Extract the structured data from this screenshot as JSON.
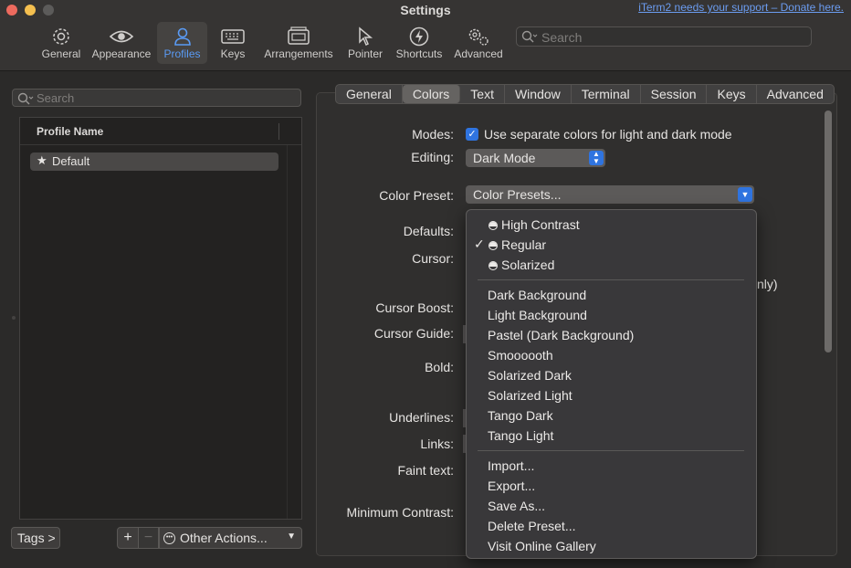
{
  "window": {
    "title": "Settings",
    "donate_link": "iTerm2 needs your support – Donate here."
  },
  "toolbar": {
    "items": [
      {
        "label": "General",
        "icon": "gear-icon"
      },
      {
        "label": "Appearance",
        "icon": "eye-icon"
      },
      {
        "label": "Profiles",
        "icon": "person-icon",
        "active": true
      },
      {
        "label": "Keys",
        "icon": "keyboard-icon"
      },
      {
        "label": "Arrangements",
        "icon": "window-stack-icon"
      },
      {
        "label": "Pointer",
        "icon": "pointer-icon"
      },
      {
        "label": "Shortcuts",
        "icon": "bolt-icon"
      },
      {
        "label": "Advanced",
        "icon": "gears-icon"
      }
    ],
    "search_placeholder": "Search"
  },
  "profiles": {
    "search_placeholder": "Search",
    "column_header": "Profile Name",
    "rows": [
      {
        "name": "Default",
        "is_default": true
      }
    ],
    "tags_button": "Tags >",
    "add_button": "+",
    "remove_button": "−",
    "other_actions": "Other Actions..."
  },
  "tabs": [
    "General",
    "Colors",
    "Text",
    "Window",
    "Terminal",
    "Session",
    "Keys",
    "Advanced"
  ],
  "active_tab": "Colors",
  "colors_pane": {
    "modes_label": "Modes:",
    "modes_checkbox_label": "Use separate colors for light and dark mode",
    "modes_checked": true,
    "editing_label": "Editing:",
    "editing_value": "Dark Mode",
    "color_preset_label": "Color Preset:",
    "color_preset_value": "Color Presets...",
    "defaults_label": "Defaults:",
    "cursor_label": "Cursor:",
    "cursor_boost_label": "Cursor Boost:",
    "cursor_guide_label": "Cursor Guide:",
    "bold_label": "Bold:",
    "underlines_label": "Underlines:",
    "links_label": "Links:",
    "faint_text_label": "Faint text:",
    "minimum_contrast_label": "Minimum Contrast:",
    "partial_text": "nly)"
  },
  "preset_menu": {
    "builtin": [
      {
        "label": "High Contrast",
        "checked": false
      },
      {
        "label": "Regular",
        "checked": true
      },
      {
        "label": "Solarized",
        "checked": false
      }
    ],
    "presets": [
      "Dark Background",
      "Light Background",
      "Pastel (Dark Background)",
      "Smoooooth",
      "Solarized Dark",
      "Solarized Light",
      "Tango Dark",
      "Tango Light"
    ],
    "actions": [
      "Import...",
      "Export...",
      "Save As...",
      "Delete Preset...",
      "Visit Online Gallery"
    ]
  },
  "colors": {
    "accent": "#2f74e0",
    "active_toolbar": "#5a9bf5",
    "link": "#6b9cf0"
  }
}
